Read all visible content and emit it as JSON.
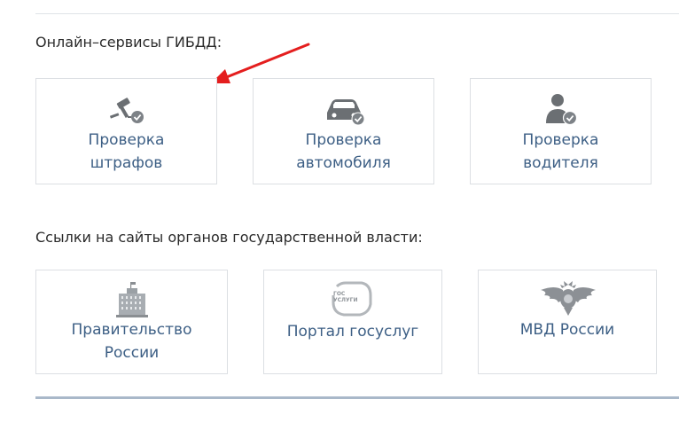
{
  "sections": {
    "online": {
      "title": "Онлайн–сервисы ГИБДД:",
      "cards": [
        {
          "label": "Проверка\nштрафов",
          "icon": "gavel-check-icon"
        },
        {
          "label": "Проверка\nавтомобиля",
          "icon": "car-check-icon"
        },
        {
          "label": "Проверка\nводителя",
          "icon": "person-check-icon"
        }
      ]
    },
    "links": {
      "title": "Ссылки на сайты органов государственной власти:",
      "cards": [
        {
          "label": "Правительство\nРоссии",
          "icon": "government-building-icon"
        },
        {
          "label": "Портал госуслуг",
          "icon": "gosuslugi-logo-icon",
          "logo_text": "ГОС\nУСЛУГИ"
        },
        {
          "label": "МВД России",
          "icon": "mvd-eagle-emblem-icon"
        }
      ]
    }
  },
  "colors": {
    "label": "#3d5f85",
    "icon_dark": "#6b6f73",
    "check_circle": "#7d8287",
    "arrow": "#e41e1e",
    "bottom_line": "#a9b8c9"
  }
}
